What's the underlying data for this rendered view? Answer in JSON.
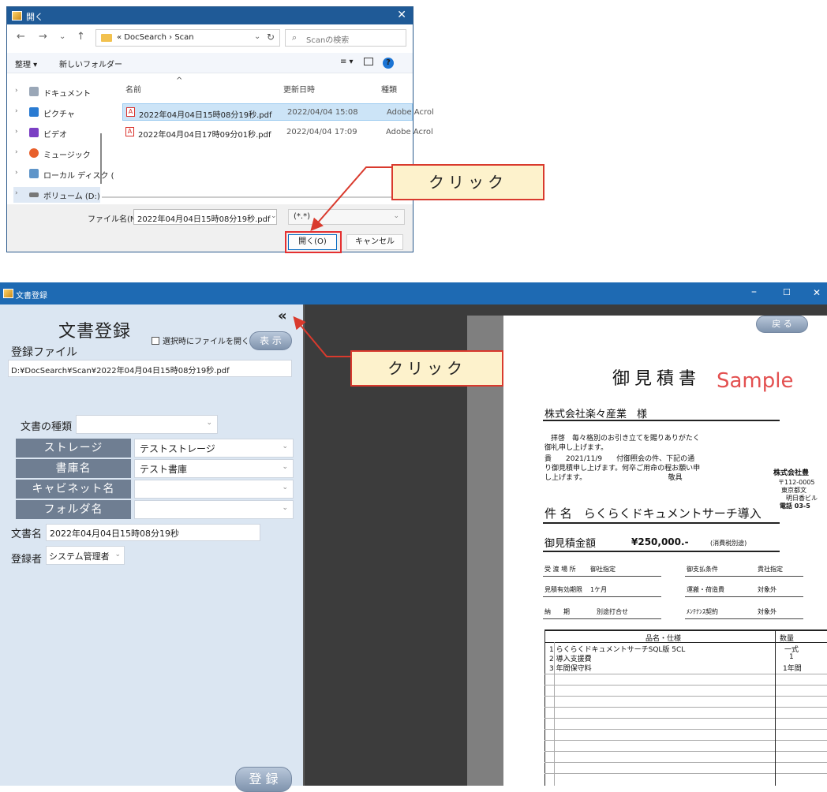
{
  "dialog": {
    "title": "開く",
    "nav": {
      "back": "←",
      "forward": "→",
      "recent": "⌄",
      "up": "↑"
    },
    "address": {
      "path": "« DocSearch › Scan"
    },
    "search_placeholder": "Scanの検索",
    "toolbar": {
      "organize": "整理 ▾",
      "new_folder": "新しいフォルダー"
    },
    "sidebar": [
      {
        "label": "ドキュメント",
        "icon": "documents-icon"
      },
      {
        "label": "ピクチャ",
        "icon": "pictures-icon"
      },
      {
        "label": "ビデオ",
        "icon": "videos-icon"
      },
      {
        "label": "ミュージック",
        "icon": "music-icon"
      },
      {
        "label": "ローカル ディスク (",
        "icon": "local-disk-icon"
      },
      {
        "label": "ボリューム (D:)",
        "icon": "volume-icon"
      }
    ],
    "columns": {
      "name": "名前",
      "modified": "更新日時",
      "type": "種類"
    },
    "files": [
      {
        "name": "2022年04月04日15時08分19秒.pdf",
        "modified": "2022/04/04 15:08",
        "type": "Adobe Acrol",
        "selected": true
      },
      {
        "name": "2022年04月04日17時09分01秒.pdf",
        "modified": "2022/04/04 17:09",
        "type": "Adobe Acrol",
        "selected": false
      }
    ],
    "filename_label": "ファイル名(N):",
    "filename_value": "2022年04月04日15時08分19秒.pdf",
    "filetype_value": "(*.*)",
    "open_button": "開く(O)",
    "cancel_button": "キャンセル"
  },
  "callouts": {
    "first": "クリック",
    "second": "クリック"
  },
  "main": {
    "title": "文書登録",
    "window_controls": {
      "minimize": "–",
      "maximize": "☐",
      "close": "✕"
    },
    "panel_title": "文書登録",
    "collapse_glyph": "«",
    "open_on_select_label": "選択時にファイルを開く",
    "show_button": "表 示",
    "reg_file_label": "登録ファイル",
    "reg_file_path": "D:¥DocSearch¥Scan¥2022年04月04日15時08分19秒.pdf",
    "doctype_label": "文書の種類",
    "doctype_value": "",
    "storage_label": "ストレージ",
    "storage_value": "テストストレージ",
    "library_label": "書庫名",
    "library_value": "テスト書庫",
    "cabinet_label": "キャビネット名",
    "cabinet_value": "",
    "folder_label": "フォルダ名",
    "folder_value": "",
    "docname_label": "文書名",
    "docname_value": "2022年04月04日15時08分19秒",
    "registrant_label": "登録者",
    "registrant_value": "システム管理者",
    "register_button": "登 録"
  },
  "document": {
    "back_button": "戻 る",
    "title": "御見積書",
    "watermark": "Sample",
    "customer": "株式会社楽々産業　様",
    "greeting1": "拝啓　毎々格別のお引き立てを賜りありがたく",
    "greeting2": "御礼申し上げます。",
    "greeting3": "貴　　2021/11/9　　付御照会の件、下記の通",
    "greeting4": "り御見積申し上げます。何卒ご用命の程お願い申",
    "greeting5": "し上げます。　　　　　　　　　　　　敬具",
    "company": "株式会社豊",
    "addr1": "〒112-0005",
    "addr2": "東京都文",
    "addr3": "明日香ビル",
    "tel": "電話 03-5",
    "subject": "件 名　らくらくドキュメントサーチ導入",
    "amount_label": "御見積金額",
    "amount": "¥250,000.-",
    "amount_note": "(消費税別途)",
    "terms": [
      {
        "k": "受 渡 場 所",
        "v": "御社指定",
        "k2": "御支払条件",
        "v2": "貴社指定"
      },
      {
        "k": "見積有効期限",
        "v": "1ケ月",
        "k2": "運搬・荷造費",
        "v2": "対象外"
      },
      {
        "k": "納　　期",
        "v": "別途打合せ",
        "k2": "ﾒﾝﾃﾅﾝｽ契約",
        "v2": "対象外"
      }
    ],
    "table_header_item": "品名・仕様",
    "table_header_qty": "数量",
    "items": [
      {
        "no": "1",
        "name": "らくらくドキュメントサーチSQL版 5CL",
        "qty": "一式"
      },
      {
        "no": "2",
        "name": "導入支援費",
        "qty": "1"
      },
      {
        "no": "3",
        "name": "年間保守料",
        "qty": "1年間"
      }
    ]
  }
}
